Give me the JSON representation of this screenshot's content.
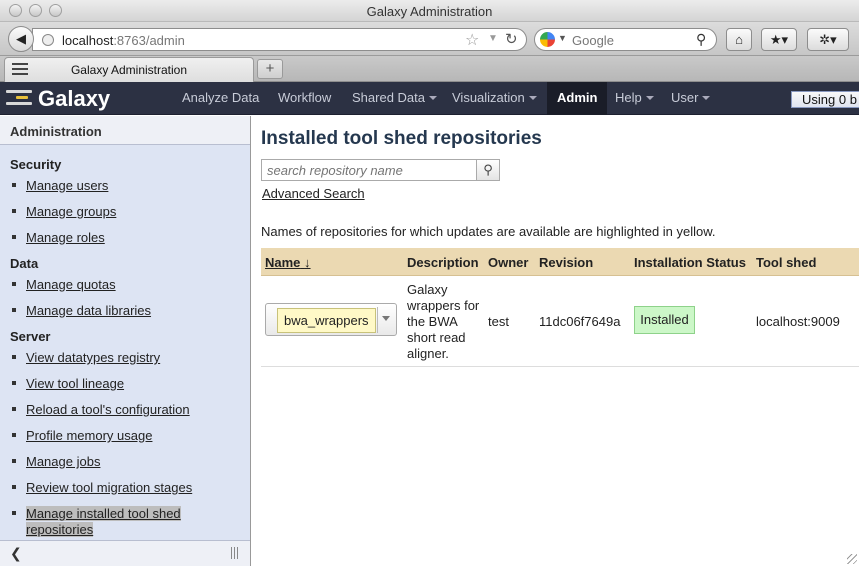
{
  "window": {
    "title": "Galaxy Administration"
  },
  "browser": {
    "url_host": "localhost",
    "url_rest": ":8763/admin",
    "search_engine": "Google",
    "tab_title": "Galaxy Administration"
  },
  "masthead": {
    "brand": "Galaxy",
    "nav": [
      "Analyze Data",
      "Workflow",
      "Shared Data",
      "Visualization",
      "Admin",
      "Help",
      "User"
    ],
    "active": "Admin",
    "quota_text": "Using 0 b"
  },
  "left": {
    "title": "Administration",
    "sections": [
      {
        "title": "Security",
        "items": [
          "Manage users",
          "Manage groups",
          "Manage roles"
        ]
      },
      {
        "title": "Data",
        "items": [
          "Manage quotas",
          "Manage data libraries"
        ]
      },
      {
        "title": "Server",
        "items": [
          "View datatypes registry",
          "View tool lineage",
          "Reload a tool's configuration",
          "Profile memory usage",
          "Manage jobs",
          "Review tool migration stages"
        ]
      }
    ],
    "selected_line1": "Manage installed tool shed",
    "selected_line2": "repositories"
  },
  "main": {
    "title": "Installed tool shed repositories",
    "search_placeholder": "search repository name",
    "advanced_search": "Advanced Search",
    "note": "Names of repositories for which updates are available are highlighted in yellow.",
    "columns": {
      "name": "Name",
      "sort_arrow": "↓",
      "description": "Description",
      "owner": "Owner",
      "revision": "Revision",
      "status": "Installation Status",
      "tool_shed": "Tool shed"
    },
    "rows": [
      {
        "name": "bwa_wrappers",
        "description": "Galaxy wrappers for the BWA short read aligner.",
        "owner": "test",
        "revision": "11dc06f7649a",
        "status": "Installed",
        "tool_shed": "localhost:9009"
      }
    ]
  },
  "colors": {
    "masthead": "#2c3143",
    "header_row": "#ebd9b2",
    "update_highlight": "#fff9c7",
    "installed": "#ccf7c8"
  }
}
